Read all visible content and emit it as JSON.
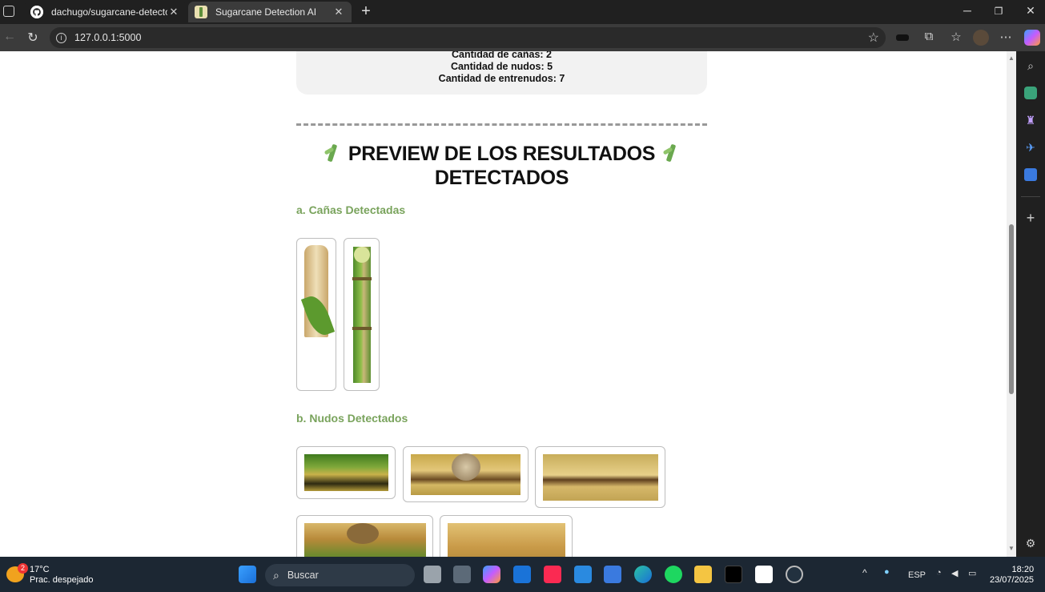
{
  "browser": {
    "tabs": [
      {
        "label": "dachugo/sugarcane-detector-ai: ",
        "icon": "github-icon",
        "active": false
      },
      {
        "label": "Sugarcane Detection AI",
        "icon": "sugarcane-icon",
        "active": true
      }
    ],
    "url": "127.0.0.1:5000"
  },
  "page": {
    "stats": {
      "canas": "Cantidad de cañas: 2",
      "nudos": "Cantidad de nudos: 5",
      "entrenudos": "Cantidad de entrenudos: 7"
    },
    "preview_title_line1": "PREVIEW DE LOS RESULTADOS",
    "preview_title_line2": "DETECTADOS",
    "section_canas": "a. Cañas Detectadas",
    "section_nudos": "b. Nudos Detectados",
    "canas_images": [
      "cane-crop-1",
      "cane-crop-2"
    ],
    "nudos_images": [
      "node-crop-1",
      "node-crop-2",
      "node-crop-3",
      "node-crop-4",
      "node-crop-5"
    ]
  },
  "taskbar": {
    "weather_temp": "17°C",
    "weather_desc": "Prac. despejado",
    "weather_badge": "2",
    "search_placeholder": "Buscar",
    "language": "ESP",
    "time": "18:20",
    "date": "23/07/2025"
  },
  "colors": {
    "section_green": "#79a35c",
    "taskbar_bg": "#1c2733"
  }
}
